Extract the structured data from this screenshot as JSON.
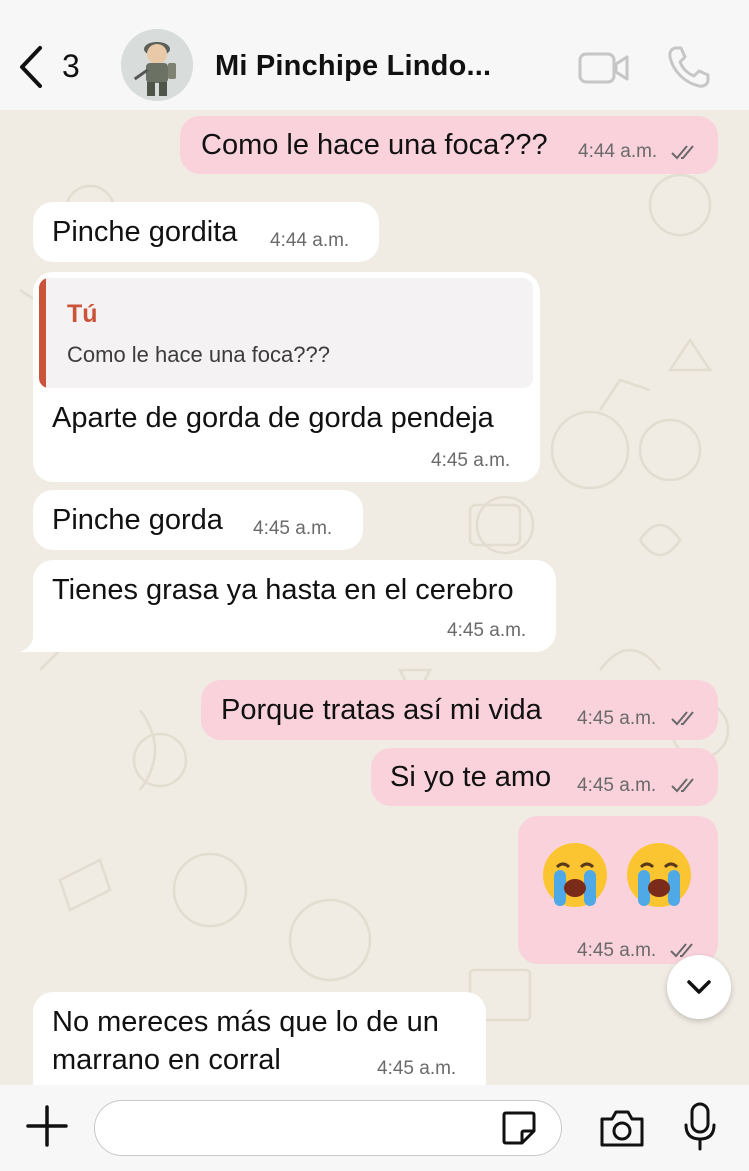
{
  "header": {
    "back_count": "3",
    "contact_name": "Mi Pinchipe Lindo..."
  },
  "messages": [
    {
      "dir": "out",
      "text": "Como le hace una foca???",
      "time": "4:44 a.m.",
      "read": true
    },
    {
      "dir": "in",
      "text": "Pinche gordita",
      "time": "4:44 a.m."
    },
    {
      "dir": "in",
      "reply_author": "Tú",
      "reply_text": "Como le hace una foca???",
      "text": "Aparte de gorda de gorda pendeja",
      "time": "4:45 a.m."
    },
    {
      "dir": "in",
      "text": "Pinche gorda",
      "time": "4:45 a.m."
    },
    {
      "dir": "in",
      "text": "Tienes grasa ya hasta en el cerebro",
      "time": "4:45 a.m."
    },
    {
      "dir": "out",
      "text": "Porque tratas así mi vida",
      "time": "4:45 a.m.",
      "read": true
    },
    {
      "dir": "out",
      "text": "Si yo te amo",
      "time": "4:45 a.m.",
      "read": true
    },
    {
      "dir": "out",
      "emoji": "loudly-crying-face x2",
      "text": "😭 😭",
      "time": "4:45 a.m.",
      "read": true
    },
    {
      "dir": "in",
      "text_line1": "No mereces más que lo de un",
      "text_line2": "marrano en corral",
      "time": "4:45 a.m."
    }
  ],
  "composer": {
    "placeholder": ""
  },
  "colors": {
    "outgoing_bubble": "#f9d2dc",
    "incoming_bubble": "#ffffff",
    "wallpaper": "#f0ebe3",
    "reply_accent": "#c9543a",
    "header_bg": "#f7f7f7"
  }
}
